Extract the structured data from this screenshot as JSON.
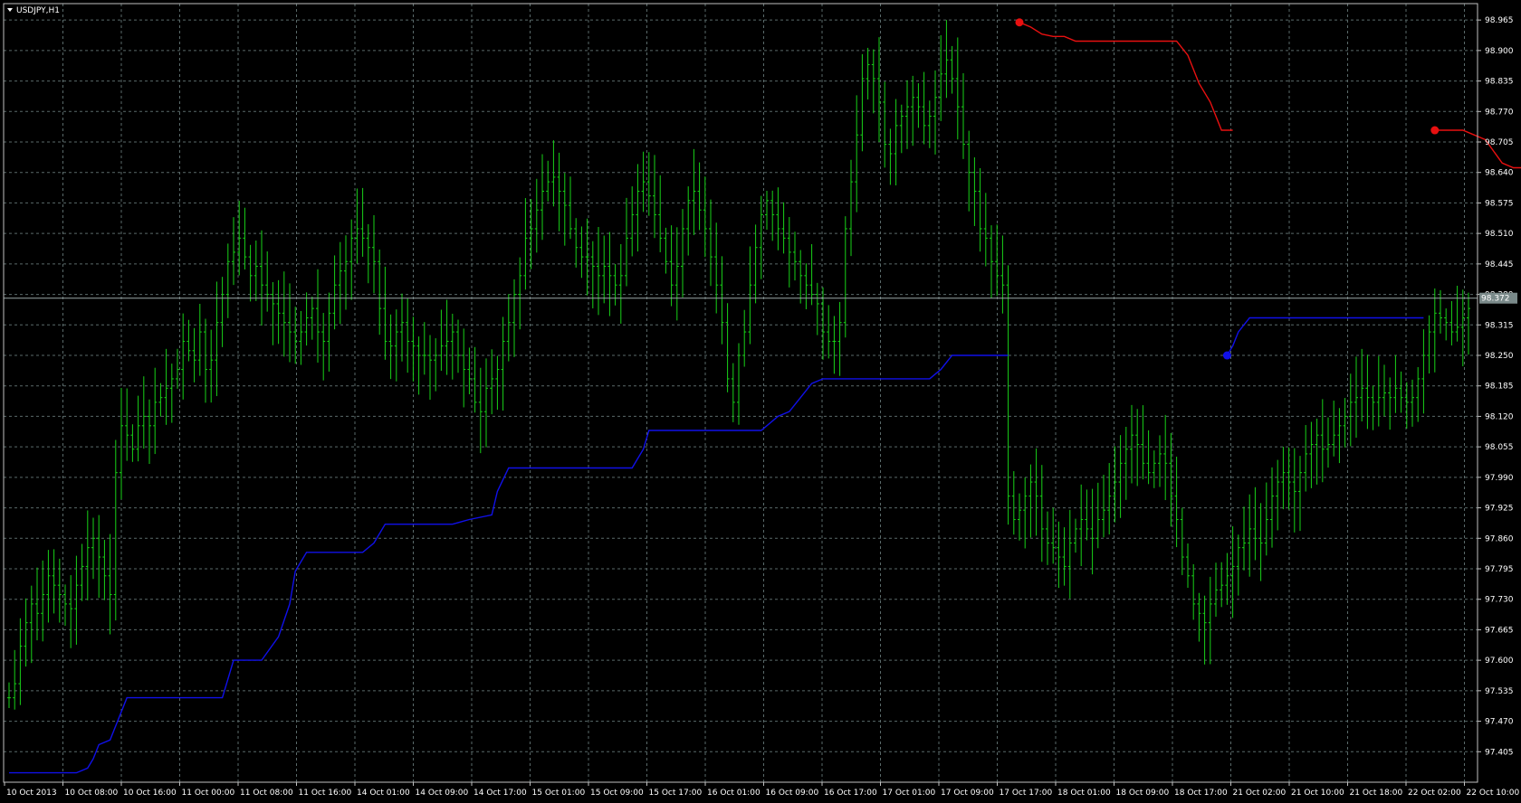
{
  "window": {
    "title": "USDJPY,H1",
    "price_tag": "98.372"
  },
  "colors": {
    "background": "#000000",
    "grid": "#5a6a6a",
    "frame": "#c0c0c0",
    "bars": "#18d218",
    "uptrend_line": "#1010e8",
    "downtrend_line": "#e81010",
    "price_tag_bg": "#7a8a8a"
  },
  "chart_data": {
    "type": "line",
    "symbol": "USDJPY",
    "timeframe": "H1",
    "ylim": [
      97.34,
      99.0
    ],
    "grid": true,
    "y_ticks": [
      "98.965",
      "98.900",
      "98.835",
      "98.770",
      "98.705",
      "98.640",
      "98.575",
      "98.510",
      "98.445",
      "98.380",
      "98.315",
      "98.250",
      "98.185",
      "98.120",
      "98.055",
      "97.990",
      "97.925",
      "97.860",
      "97.795",
      "97.730",
      "97.665",
      "97.600",
      "97.535",
      "97.470",
      "97.405"
    ],
    "x_ticks": [
      "10 Oct 2013",
      "10 Oct 08:00",
      "10 Oct 16:00",
      "11 Oct 00:00",
      "11 Oct 08:00",
      "11 Oct 16:00",
      "14 Oct 01:00",
      "14 Oct 09:00",
      "14 Oct 17:00",
      "15 Oct 01:00",
      "15 Oct 09:00",
      "15 Oct 17:00",
      "16 Oct 01:00",
      "16 Oct 09:00",
      "16 Oct 17:00",
      "17 Oct 01:00",
      "17 Oct 09:00",
      "17 Oct 17:00",
      "18 Oct 01:00",
      "18 Oct 09:00",
      "18 Oct 17:00",
      "21 Oct 02:00",
      "21 Oct 10:00",
      "21 Oct 18:00",
      "22 Oct 02:00",
      "22 Oct 10:00"
    ],
    "current_price": 98.372,
    "ohlc_bars": {
      "close": [
        97.52,
        97.55,
        97.63,
        97.68,
        97.72,
        97.7,
        97.74,
        97.78,
        97.76,
        97.74,
        97.72,
        97.71,
        97.76,
        97.8,
        97.84,
        97.86,
        97.82,
        97.78,
        97.74,
        98.0,
        98.1,
        98.08,
        98.05,
        98.1,
        98.12,
        98.1,
        98.15,
        98.16,
        98.18,
        98.2,
        98.22,
        98.28,
        98.26,
        98.24,
        98.3,
        98.22,
        98.24,
        98.32,
        98.38,
        98.45,
        98.47,
        98.5,
        98.46,
        98.42,
        98.44,
        98.4,
        98.38,
        98.36,
        98.34,
        98.32,
        98.3,
        98.28,
        98.3,
        98.33,
        98.35,
        98.3,
        98.28,
        98.34,
        98.4,
        98.43,
        98.45,
        98.5,
        98.52,
        98.5,
        98.48,
        98.45,
        98.35,
        98.28,
        98.27,
        98.3,
        98.32,
        98.28,
        98.27,
        98.25,
        98.25,
        98.24,
        98.25,
        98.27,
        98.28,
        98.3,
        98.25,
        98.22,
        98.2,
        98.15,
        98.13,
        98.18,
        98.2,
        98.22,
        98.28,
        98.32,
        98.38,
        98.42,
        98.5,
        98.52,
        98.56,
        98.6,
        98.62,
        98.63,
        98.6,
        98.57,
        98.52,
        98.48,
        98.46,
        98.46,
        98.44,
        98.42,
        98.44,
        98.42,
        98.4,
        98.42,
        98.5,
        98.55,
        98.6,
        98.62,
        98.59,
        98.55,
        98.5,
        98.45,
        98.4,
        98.44,
        98.52,
        98.58,
        98.6,
        98.56,
        98.52,
        98.46,
        98.4,
        98.32,
        98.2,
        98.15,
        98.25,
        98.3,
        98.4,
        98.48,
        98.55,
        98.58,
        98.55,
        98.52,
        98.5,
        98.47,
        98.45,
        98.42,
        98.4,
        98.38,
        98.36,
        98.3,
        98.28,
        98.28,
        98.32,
        98.52,
        98.62,
        98.72,
        98.84,
        98.87,
        98.84,
        98.79,
        98.7,
        98.68,
        98.74,
        98.76,
        98.78,
        98.8,
        98.78,
        98.74,
        98.76,
        98.8,
        98.85,
        98.88,
        98.84,
        98.78,
        98.7,
        98.64,
        98.6,
        98.52,
        98.5,
        98.45,
        98.42,
        98.4,
        97.95,
        97.9,
        97.92,
        97.95,
        97.98,
        97.95,
        97.88,
        97.85,
        97.84,
        97.82,
        97.8,
        97.85,
        97.88,
        97.9,
        97.88,
        97.86,
        97.9,
        97.92,
        97.95,
        97.98,
        98.02,
        98.05,
        98.08,
        98.06,
        98.02,
        98.0,
        98.02,
        98.04,
        98.02,
        97.95,
        97.9,
        97.82,
        97.78,
        97.72,
        97.7,
        97.68,
        97.72,
        97.75,
        97.76,
        97.78,
        97.8,
        97.84,
        97.85,
        97.88,
        97.86,
        97.85,
        97.9,
        97.95,
        97.98,
        98.0,
        97.98,
        97.96,
        98.0,
        98.04,
        98.06,
        98.08,
        98.05,
        98.06,
        98.08,
        98.1,
        98.12,
        98.15,
        98.16,
        98.18,
        98.16,
        98.15,
        98.16,
        98.17,
        98.16,
        98.18,
        98.16,
        98.15,
        98.16,
        98.2,
        98.25,
        98.3,
        98.34,
        98.33,
        98.32,
        98.3,
        98.31,
        98.33,
        98.35,
        98.38,
        98.37
      ],
      "range_note": "hourly bars approximated from the plotted price path"
    },
    "series": [
      {
        "color": "#1010e8",
        "segments": [
          [
            [
              0,
              97.36
            ],
            [
              12,
              97.36
            ],
            [
              14,
              97.37
            ],
            [
              15,
              97.39
            ],
            [
              16,
              97.42
            ],
            [
              18,
              97.43
            ],
            [
              21,
              97.52
            ],
            [
              38,
              97.52
            ],
            [
              40,
              97.6
            ],
            [
              45,
              97.6
            ],
            [
              48,
              97.65
            ],
            [
              50,
              97.72
            ],
            [
              51,
              97.79
            ],
            [
              53,
              97.83
            ],
            [
              63,
              97.83
            ],
            [
              65,
              97.85
            ],
            [
              67,
              97.89
            ],
            [
              79,
              97.89
            ],
            [
              82,
              97.9
            ],
            [
              86,
              97.91
            ],
            [
              87,
              97.96
            ],
            [
              89,
              98.01
            ],
            [
              111,
              98.01
            ],
            [
              113,
              98.05
            ],
            [
              114,
              98.09
            ],
            [
              134,
              98.09
            ],
            [
              137,
              98.12
            ],
            [
              139,
              98.13
            ],
            [
              143,
              98.19
            ],
            [
              145,
              98.2
            ],
            [
              164,
              98.2
            ],
            [
              166,
              98.22
            ],
            [
              168,
              98.25
            ],
            [
              178,
              98.25
            ]
          ]
        ]
      },
      {
        "color": "#1010e8",
        "segments": [
          [
            [
              217,
              98.25
            ],
            [
              218,
              98.27
            ],
            [
              219,
              98.3
            ],
            [
              221,
              98.33
            ],
            [
              225,
              98.33
            ],
            [
              252,
              98.33
            ]
          ]
        ]
      },
      {
        "color": "#1010e8",
        "segments": [
          [
            [
              344,
              97.62
            ],
            [
              345,
              97.65
            ],
            [
              347,
              97.68
            ],
            [
              349,
              97.72
            ],
            [
              351,
              97.78
            ],
            [
              353,
              97.82
            ],
            [
              355,
              97.84
            ],
            [
              361,
              97.84
            ],
            [
              363,
              97.86
            ],
            [
              365,
              97.89
            ],
            [
              367,
              97.91
            ],
            [
              373,
              97.91
            ],
            [
              377,
              97.94
            ],
            [
              380,
              98.0
            ],
            [
              383,
              98.04
            ],
            [
              385,
              98.07
            ],
            [
              394,
              98.07
            ],
            [
              396,
              98.09
            ],
            [
              398,
              98.12
            ]
          ]
        ]
      },
      {
        "color": "#e81010",
        "segments": [
          [
            [
              180,
              98.96
            ],
            [
              182,
              98.95
            ],
            [
              184,
              98.935
            ],
            [
              186,
              98.93
            ],
            [
              188,
              98.93
            ],
            [
              190,
              98.92
            ],
            [
              208,
              98.92
            ],
            [
              210,
              98.89
            ],
            [
              212,
              98.83
            ],
            [
              214,
              98.79
            ],
            [
              216,
              98.73
            ],
            [
              218,
              98.73
            ]
          ]
        ]
      },
      {
        "color": "#e81010",
        "segments": [
          [
            [
              254,
              98.73
            ],
            [
              259,
              98.73
            ],
            [
              261,
              98.72
            ],
            [
              263,
              98.71
            ],
            [
              266,
              98.66
            ],
            [
              268,
              98.65
            ],
            [
              272,
              98.65
            ],
            [
              274,
              98.6
            ],
            [
              276,
              98.45
            ],
            [
              277,
              98.42
            ],
            [
              278,
              98.41
            ],
            [
              280,
              98.41
            ],
            [
              282,
              98.39
            ],
            [
              286,
              98.38
            ],
            [
              304,
              98.38
            ],
            [
              306,
              98.3
            ],
            [
              308,
              98.2
            ],
            [
              310,
              98.15
            ],
            [
              313,
              98.14
            ],
            [
              347,
              98.14
            ]
          ]
        ]
      }
    ],
    "markers": [
      {
        "color": "#e81010",
        "x": 180,
        "y": 98.96
      },
      {
        "color": "#1010e8",
        "x": 217,
        "y": 98.25
      },
      {
        "color": "#e81010",
        "x": 254,
        "y": 98.73
      },
      {
        "color": "#1010e8",
        "x": 344,
        "y": 97.62
      }
    ]
  }
}
